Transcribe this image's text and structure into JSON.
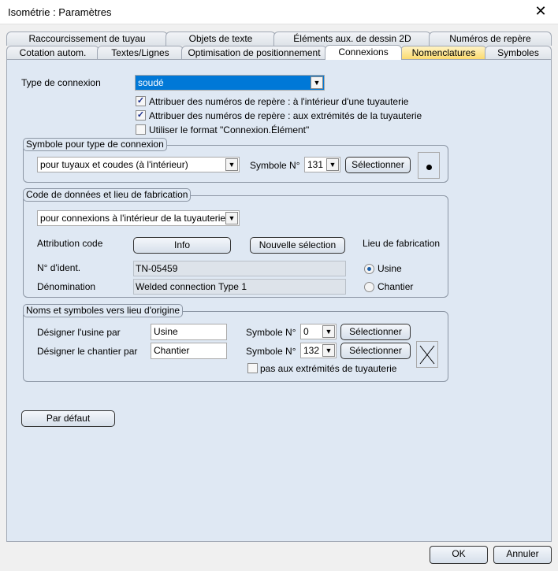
{
  "window": {
    "title": "Isométrie : Paramètres",
    "close_icon": "close-icon"
  },
  "tabs_row1": [
    "Raccourcissement de tuyau",
    "Objets de texte",
    "Éléments aux. de dessin 2D",
    "Numéros de repère"
  ],
  "tabs_row2": [
    "Cotation autom.",
    "Textes/Lignes",
    "Optimisation de positionnement",
    "Connexions",
    "Nomenclatures",
    "Symboles"
  ],
  "active_tab": "Connexions",
  "connection": {
    "label": "Type de connexion",
    "value": "soudé",
    "checkboxes": [
      {
        "label": "Attribuer des numéros de repère : à l'intérieur d'une tuyauterie",
        "checked": true
      },
      {
        "label": "Attribuer des numéros de repère : aux extrémités de la tuyauterie",
        "checked": true
      },
      {
        "label": "Utiliser le format \"Connexion.Élément\"",
        "checked": false
      }
    ]
  },
  "symbol_group": {
    "title": "Symbole pour type de connexion",
    "combo": "pour tuyaux et coudes (à l'intérieur)",
    "symbol_label": "Symbole N°",
    "symbol_value": "131",
    "select_label": "Sélectionner"
  },
  "code_group": {
    "title": "Code de données et lieu de fabrication",
    "combo": "pour connexions à l'intérieur de la tuyauterie",
    "attribution_label": "Attribution code",
    "info_label": "Info",
    "new_selection_label": "Nouvelle sélection",
    "place_label": "Lieu de fabrication",
    "ident_label": "N° d'ident.",
    "ident_value": "TN-05459",
    "denom_label": "Dénomination",
    "denom_value": "Welded connection Type 1",
    "radio_usine": "Usine",
    "radio_chantier": "Chantier",
    "selected_place": "Usine"
  },
  "names_group": {
    "title": "Noms et symboles vers lieu d'origine",
    "usine_label": "Désigner l'usine par",
    "usine_value": "Usine",
    "chantier_label": "Désigner le chantier par",
    "chantier_value": "Chantier",
    "symbol_label": "Symbole N°",
    "usine_symbol": "0",
    "chantier_symbol": "132",
    "select_label": "Sélectionner",
    "not_ends_label": "pas aux extrémités de tuyauterie",
    "not_ends_checked": false
  },
  "default_label": "Par défaut",
  "footer": {
    "ok": "OK",
    "cancel": "Annuler"
  }
}
